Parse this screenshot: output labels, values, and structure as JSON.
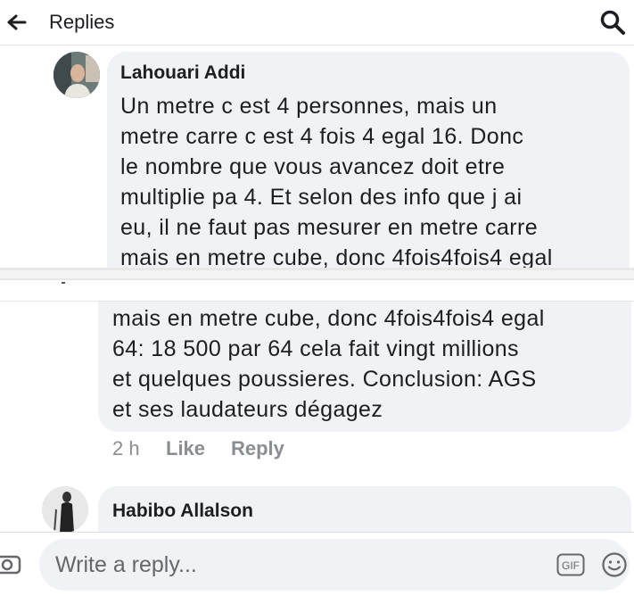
{
  "header": {
    "title": "Replies",
    "back_icon": "arrow-left-icon",
    "search_icon": "search-icon"
  },
  "comments": [
    {
      "author": "Lahouari Addi",
      "lines": [
        "Un metre c est 4 personnes, mais un",
        "metre carre c est 4 fois 4 egal 16. Donc",
        "le nombre que vous avancez doit etre",
        "multiplie pa 4. Et selon des info que j ai",
        "eu, il ne faut pas mesurer en metre carre",
        "mais en metre cube, donc 4fois4fois4 egal"
      ]
    },
    {
      "lines": [
        "mais en metre cube, donc 4fois4fois4 egal",
        "64: 18 500 par 64 cela fait vingt millions",
        "et quelques poussieres. Conclusion: AGS",
        "et ses laudateurs dégagez"
      ],
      "time": "2 h",
      "like_label": "Like",
      "reply_label": "Reply"
    },
    {
      "author": "Habibo Allalson"
    }
  ],
  "composer": {
    "placeholder": "Write a reply...",
    "gif_label": "GIF"
  },
  "colors": {
    "bubble": "#f0f2f5",
    "meta": "#8a8d91",
    "text": "#1c1e21"
  }
}
